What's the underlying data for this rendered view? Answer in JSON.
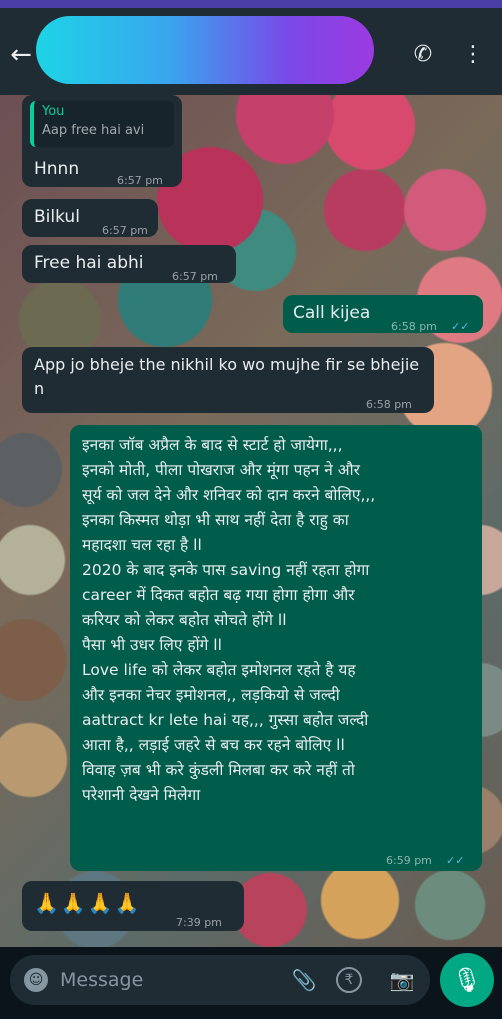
{
  "header": {
    "back_icon": "←",
    "call_icon": "✆",
    "more_icon": "⋮"
  },
  "messages": [
    {
      "reply_to": {
        "author": "You",
        "text": "Aap free hai avi"
      },
      "text": "Hnnn",
      "time": "6:57 pm"
    },
    {
      "text": "Bilkul",
      "time": "6:57 pm"
    },
    {
      "text": "Free hai abhi",
      "time": "6:57 pm"
    },
    {
      "text": "Call kijea",
      "time": "6:58 pm",
      "ticks": "✓✓"
    },
    {
      "text": "App jo bheje the nikhil ko wo mujhe fir se bhejie n",
      "time": "6:58 pm"
    },
    {
      "text": "इनका जॉब अप्रैल के बाद से स्टार्ट हो जायेगा,,,\nइनको मोती, पीला पोखराज  और मूंगा पहन ने और\nसूर्य को जल देने और शनिवर को दान करने बोलिए,,,\nइनका किस्मत थोड़ा भी साथ नहीं देता है राहु का\nमहादशा चल रहा है ll\n2020 के बाद इनके पास saving नहीं रहता होगा\ncareer में दिकत बहोत बढ़ गया होगा होगा और\nकरियर को लेकर बहोत सोचते होंगे ll\nपैसा भी उधर लिए होंगे ll\nLove life को लेकर बहोत इमोशनल रहते है यह\nऔर इनका नेचर इमोशनल,, लड़कियो से जल्दी\naattract kr lete hai यह,,, गुस्सा बहोत जल्दी\nआता है,, लड़ाई जहरे से बच कर रहने बोलिए ll\nविवाह ज़ब भी करे कुंडली मिलबा कर करे नहीं तो\nपरेशानी देखने मिलेगा",
      "time": "6:59 pm",
      "ticks": "✓✓"
    },
    {
      "text": "🙏🙏🙏🙏",
      "time": "7:39 pm"
    }
  ],
  "footer": {
    "placeholder": "Message",
    "emoji_icon": "☺",
    "attach_icon": "📎",
    "rupee_icon": "₹",
    "camera_icon": "📷",
    "mic_icon": "🎙"
  },
  "colors": {
    "accent": "#00a884",
    "outgoing_bubble": "#005c4b",
    "incoming_bubble": "#1f2c34"
  }
}
